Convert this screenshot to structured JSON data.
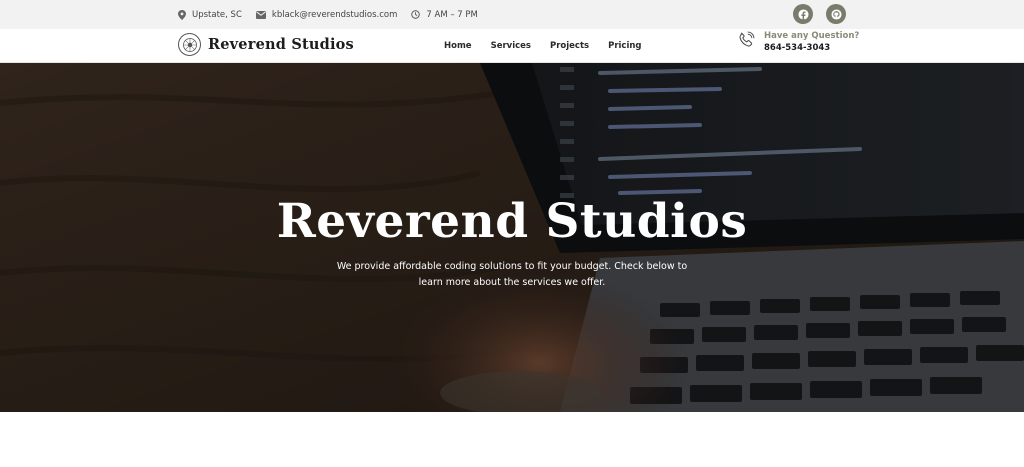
{
  "topbar": {
    "location": "Upstate, SC",
    "email": "kblack@reverendstudios.com",
    "hours": "7 AM – 7 PM",
    "icons": [
      "map-pin-icon",
      "mail-icon",
      "clock-icon"
    ],
    "social": [
      "facebook-icon",
      "github-icon"
    ]
  },
  "header": {
    "brand": "Reverend Studios",
    "nav": [
      "Home",
      "Services",
      "Projects",
      "Pricing"
    ],
    "contact_question": "Have any Question?",
    "contact_phone": "864-534-3043"
  },
  "hero": {
    "title": "Reverend Studios",
    "subtitle": "We provide affordable coding solutions to fit your budget. Check below to learn more about the services we offer."
  },
  "colors": {
    "accent": "#7a7b6a",
    "accent_text": "#8a8b78",
    "topbar_bg": "#f2f2f2",
    "hero_text": "#ffffff"
  }
}
